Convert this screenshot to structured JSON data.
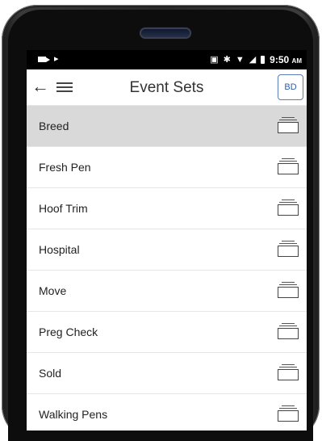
{
  "statusbar": {
    "time": "9:50",
    "ampm": "AM"
  },
  "header": {
    "title": "Event Sets",
    "avatar_initials": "BD"
  },
  "event_sets": [
    {
      "label": "Breed",
      "selected": true
    },
    {
      "label": "Fresh Pen",
      "selected": false
    },
    {
      "label": "Hoof Trim",
      "selected": false
    },
    {
      "label": "Hospital",
      "selected": false
    },
    {
      "label": "Move",
      "selected": false
    },
    {
      "label": "Preg Check",
      "selected": false
    },
    {
      "label": "Sold",
      "selected": false
    },
    {
      "label": "Walking Pens",
      "selected": false
    }
  ],
  "icons": {
    "back": "arrow-left-icon",
    "menu": "hamburger-menu-icon",
    "row": "stack-icon"
  },
  "colors": {
    "selected_row": "#d9d9d9",
    "avatar_border": "#5a7fb8"
  }
}
